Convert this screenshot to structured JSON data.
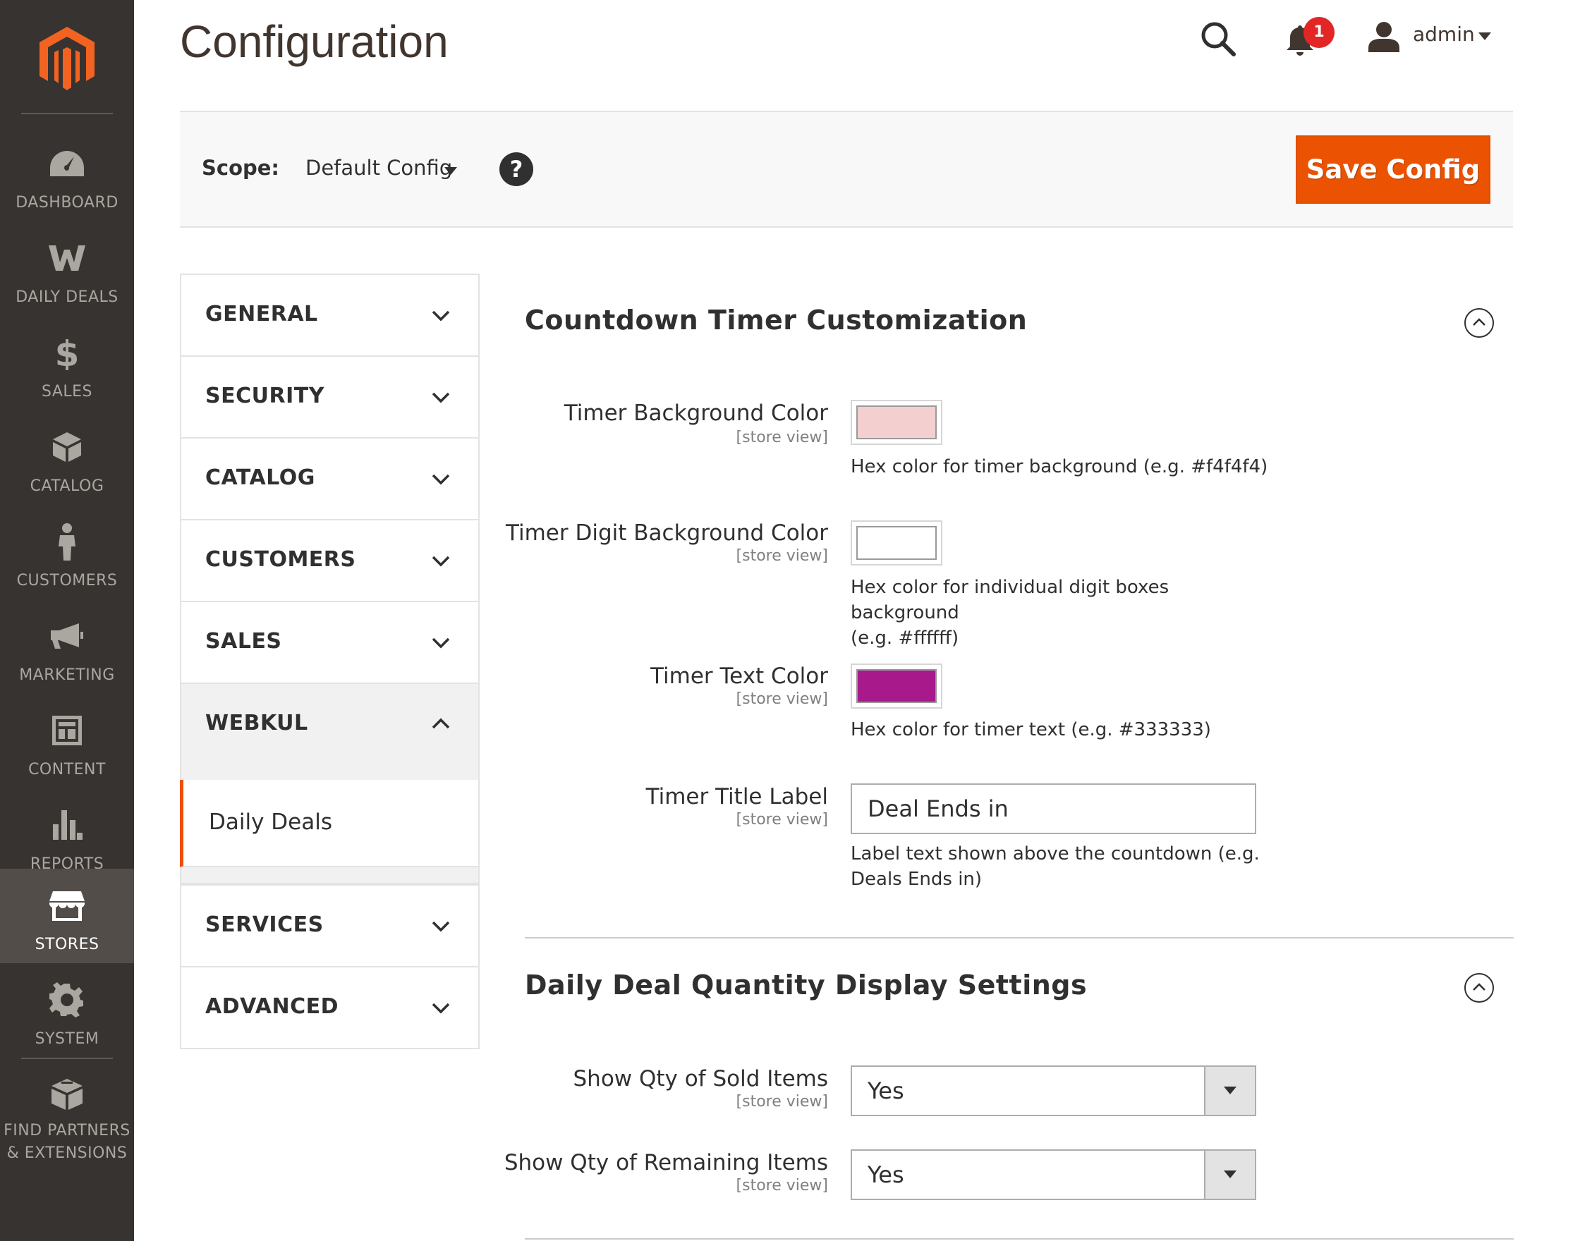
{
  "page": {
    "title": "Configuration"
  },
  "menu": {
    "items": [
      {
        "label": "DASHBOARD",
        "icon": "dashboard-icon"
      },
      {
        "label": "DAILY DEALS",
        "icon": "webkul-icon"
      },
      {
        "label": "SALES",
        "icon": "dollar-icon"
      },
      {
        "label": "CATALOG",
        "icon": "box-icon"
      },
      {
        "label": "CUSTOMERS",
        "icon": "person-icon"
      },
      {
        "label": "MARKETING",
        "icon": "megaphone-icon"
      },
      {
        "label": "CONTENT",
        "icon": "layout-icon"
      },
      {
        "label": "REPORTS",
        "icon": "bar-chart-icon"
      },
      {
        "label": "STORES",
        "icon": "storefront-icon",
        "active": true
      },
      {
        "label": "SYSTEM",
        "icon": "gear-icon"
      },
      {
        "label_line1": "FIND PARTNERS",
        "label_line2": "& EXTENSIONS",
        "icon": "blocks-icon"
      }
    ]
  },
  "header": {
    "notification_count": "1",
    "username": "admin"
  },
  "scope": {
    "label": "Scope:",
    "value": "Default Config",
    "help": "?",
    "save_label": "Save Config"
  },
  "tabs": {
    "general": "GENERAL",
    "security": "SECURITY",
    "catalog": "CATALOG",
    "customers": "CUSTOMERS",
    "sales": "SALES",
    "webkul": "WEBKUL",
    "webkul_sub": "Daily Deals",
    "services": "SERVICES",
    "advanced": "ADVANCED"
  },
  "sections": {
    "countdown": {
      "title": "Countdown Timer Customization",
      "fields": {
        "bg_color": {
          "label": "Timer Background Color",
          "scope": "[store view]",
          "color": "#f3cfcf",
          "note": "Hex color for timer background (e.g. #f4f4f4)"
        },
        "digit_bg_color": {
          "label": "Timer Digit Background Color",
          "scope": "[store view]",
          "color": "#ffffff",
          "note_line1": "Hex color for individual digit boxes background",
          "note_line2": "(e.g. #ffffff)"
        },
        "text_color": {
          "label": "Timer Text Color",
          "scope": "[store view]",
          "color": "#a8198c",
          "note": "Hex color for timer text (e.g. #333333)"
        },
        "title_label": {
          "label": "Timer Title Label",
          "scope": "[store view]",
          "value": "Deal Ends in",
          "note_line1": "Label text shown above the countdown (e.g.",
          "note_line2": "Deals Ends in)"
        }
      }
    },
    "qty": {
      "title": "Daily Deal Quantity Display Settings",
      "fields": {
        "sold": {
          "label": "Show Qty of Sold Items",
          "scope": "[store view]",
          "value": "Yes"
        },
        "remaining": {
          "label": "Show Qty of Remaining Items",
          "scope": "[store view]",
          "value": "Yes"
        }
      }
    }
  },
  "colors": {
    "accent": "#eb5202",
    "menu_bg": "#373330",
    "badge": "#e22626"
  }
}
